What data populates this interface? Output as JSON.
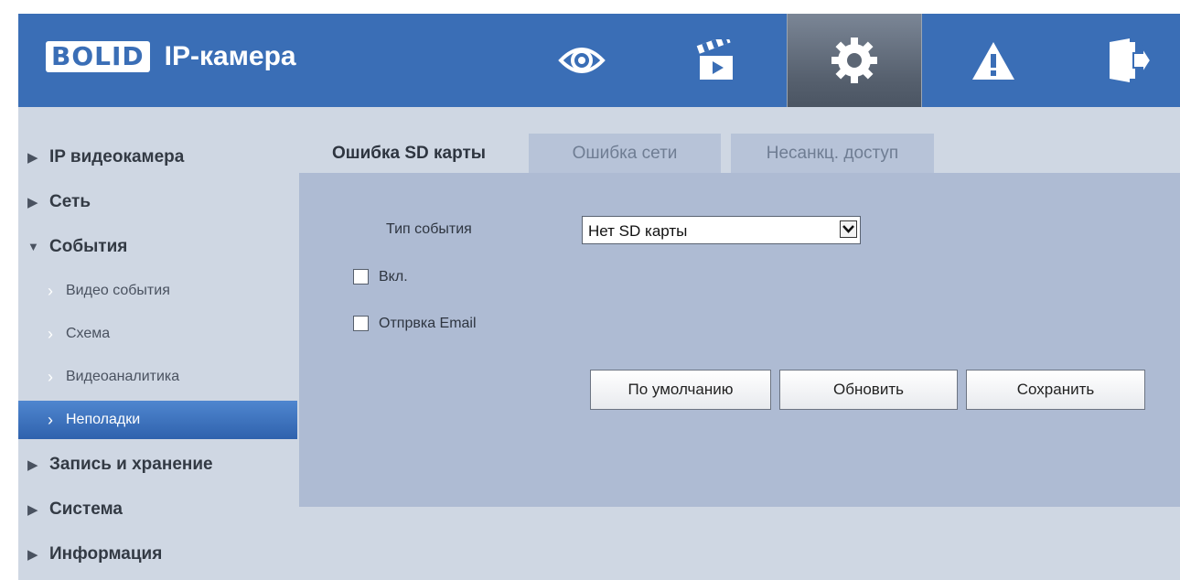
{
  "header": {
    "logo_text": "BOLID",
    "title": "IP-камера",
    "nav": [
      {
        "icon": "eye-icon",
        "label": "live-view"
      },
      {
        "icon": "clapperboard-icon",
        "label": "playback"
      },
      {
        "icon": "gear-icon",
        "label": "setup",
        "active": true
      },
      {
        "icon": "warning-icon",
        "label": "alarm"
      },
      {
        "icon": "logout-icon",
        "label": "logout"
      }
    ],
    "colors": {
      "bar": "#3a6eb6",
      "active": "#5c6674"
    }
  },
  "sidebar": {
    "items": [
      {
        "label": "IP видеокамера",
        "state": "collapsed"
      },
      {
        "label": "Сеть",
        "state": "collapsed"
      },
      {
        "label": "События",
        "state": "expanded"
      },
      {
        "label": "Запись и хранение",
        "state": "collapsed"
      },
      {
        "label": "Система",
        "state": "collapsed"
      },
      {
        "label": "Информация",
        "state": "collapsed"
      }
    ],
    "sub_items": [
      {
        "label": "Видео события"
      },
      {
        "label": "Схема"
      },
      {
        "label": "Видеоаналитика"
      },
      {
        "label": "Неполадки",
        "selected": true
      }
    ]
  },
  "tabs": [
    {
      "label": "Ошибка SD карты",
      "active": true
    },
    {
      "label": "Ошибка сети"
    },
    {
      "label": "Несанкц. доступ"
    }
  ],
  "form": {
    "event_type_label": "Тип события",
    "event_type_value": "Нет SD карты",
    "enable_label": "Вкл.",
    "enable_checked": false,
    "email_label": "Отпрвка Email",
    "email_checked": false
  },
  "buttons": {
    "default_label": "По умолчанию",
    "refresh_label": "Обновить",
    "save_label": "Сохранить"
  }
}
